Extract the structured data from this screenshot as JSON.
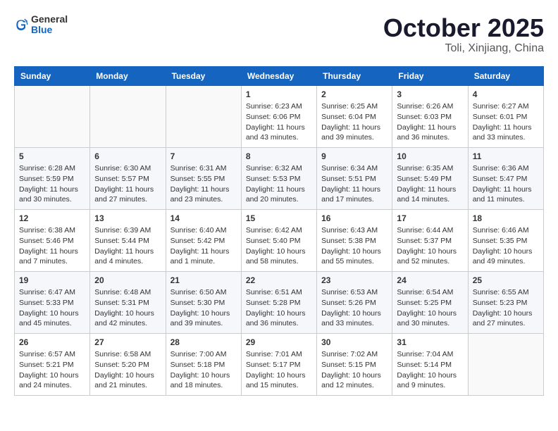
{
  "header": {
    "logo_line1": "General",
    "logo_line2": "Blue",
    "month_title": "October 2025",
    "location": "Toli, Xinjiang, China"
  },
  "weekdays": [
    "Sunday",
    "Monday",
    "Tuesday",
    "Wednesday",
    "Thursday",
    "Friday",
    "Saturday"
  ],
  "weeks": [
    [
      {
        "day": "",
        "sunrise": "",
        "sunset": "",
        "daylight": ""
      },
      {
        "day": "",
        "sunrise": "",
        "sunset": "",
        "daylight": ""
      },
      {
        "day": "",
        "sunrise": "",
        "sunset": "",
        "daylight": ""
      },
      {
        "day": "1",
        "sunrise": "Sunrise: 6:23 AM",
        "sunset": "Sunset: 6:06 PM",
        "daylight": "Daylight: 11 hours and 43 minutes."
      },
      {
        "day": "2",
        "sunrise": "Sunrise: 6:25 AM",
        "sunset": "Sunset: 6:04 PM",
        "daylight": "Daylight: 11 hours and 39 minutes."
      },
      {
        "day": "3",
        "sunrise": "Sunrise: 6:26 AM",
        "sunset": "Sunset: 6:03 PM",
        "daylight": "Daylight: 11 hours and 36 minutes."
      },
      {
        "day": "4",
        "sunrise": "Sunrise: 6:27 AM",
        "sunset": "Sunset: 6:01 PM",
        "daylight": "Daylight: 11 hours and 33 minutes."
      }
    ],
    [
      {
        "day": "5",
        "sunrise": "Sunrise: 6:28 AM",
        "sunset": "Sunset: 5:59 PM",
        "daylight": "Daylight: 11 hours and 30 minutes."
      },
      {
        "day": "6",
        "sunrise": "Sunrise: 6:30 AM",
        "sunset": "Sunset: 5:57 PM",
        "daylight": "Daylight: 11 hours and 27 minutes."
      },
      {
        "day": "7",
        "sunrise": "Sunrise: 6:31 AM",
        "sunset": "Sunset: 5:55 PM",
        "daylight": "Daylight: 11 hours and 23 minutes."
      },
      {
        "day": "8",
        "sunrise": "Sunrise: 6:32 AM",
        "sunset": "Sunset: 5:53 PM",
        "daylight": "Daylight: 11 hours and 20 minutes."
      },
      {
        "day": "9",
        "sunrise": "Sunrise: 6:34 AM",
        "sunset": "Sunset: 5:51 PM",
        "daylight": "Daylight: 11 hours and 17 minutes."
      },
      {
        "day": "10",
        "sunrise": "Sunrise: 6:35 AM",
        "sunset": "Sunset: 5:49 PM",
        "daylight": "Daylight: 11 hours and 14 minutes."
      },
      {
        "day": "11",
        "sunrise": "Sunrise: 6:36 AM",
        "sunset": "Sunset: 5:47 PM",
        "daylight": "Daylight: 11 hours and 11 minutes."
      }
    ],
    [
      {
        "day": "12",
        "sunrise": "Sunrise: 6:38 AM",
        "sunset": "Sunset: 5:46 PM",
        "daylight": "Daylight: 11 hours and 7 minutes."
      },
      {
        "day": "13",
        "sunrise": "Sunrise: 6:39 AM",
        "sunset": "Sunset: 5:44 PM",
        "daylight": "Daylight: 11 hours and 4 minutes."
      },
      {
        "day": "14",
        "sunrise": "Sunrise: 6:40 AM",
        "sunset": "Sunset: 5:42 PM",
        "daylight": "Daylight: 11 hours and 1 minute."
      },
      {
        "day": "15",
        "sunrise": "Sunrise: 6:42 AM",
        "sunset": "Sunset: 5:40 PM",
        "daylight": "Daylight: 10 hours and 58 minutes."
      },
      {
        "day": "16",
        "sunrise": "Sunrise: 6:43 AM",
        "sunset": "Sunset: 5:38 PM",
        "daylight": "Daylight: 10 hours and 55 minutes."
      },
      {
        "day": "17",
        "sunrise": "Sunrise: 6:44 AM",
        "sunset": "Sunset: 5:37 PM",
        "daylight": "Daylight: 10 hours and 52 minutes."
      },
      {
        "day": "18",
        "sunrise": "Sunrise: 6:46 AM",
        "sunset": "Sunset: 5:35 PM",
        "daylight": "Daylight: 10 hours and 49 minutes."
      }
    ],
    [
      {
        "day": "19",
        "sunrise": "Sunrise: 6:47 AM",
        "sunset": "Sunset: 5:33 PM",
        "daylight": "Daylight: 10 hours and 45 minutes."
      },
      {
        "day": "20",
        "sunrise": "Sunrise: 6:48 AM",
        "sunset": "Sunset: 5:31 PM",
        "daylight": "Daylight: 10 hours and 42 minutes."
      },
      {
        "day": "21",
        "sunrise": "Sunrise: 6:50 AM",
        "sunset": "Sunset: 5:30 PM",
        "daylight": "Daylight: 10 hours and 39 minutes."
      },
      {
        "day": "22",
        "sunrise": "Sunrise: 6:51 AM",
        "sunset": "Sunset: 5:28 PM",
        "daylight": "Daylight: 10 hours and 36 minutes."
      },
      {
        "day": "23",
        "sunrise": "Sunrise: 6:53 AM",
        "sunset": "Sunset: 5:26 PM",
        "daylight": "Daylight: 10 hours and 33 minutes."
      },
      {
        "day": "24",
        "sunrise": "Sunrise: 6:54 AM",
        "sunset": "Sunset: 5:25 PM",
        "daylight": "Daylight: 10 hours and 30 minutes."
      },
      {
        "day": "25",
        "sunrise": "Sunrise: 6:55 AM",
        "sunset": "Sunset: 5:23 PM",
        "daylight": "Daylight: 10 hours and 27 minutes."
      }
    ],
    [
      {
        "day": "26",
        "sunrise": "Sunrise: 6:57 AM",
        "sunset": "Sunset: 5:21 PM",
        "daylight": "Daylight: 10 hours and 24 minutes."
      },
      {
        "day": "27",
        "sunrise": "Sunrise: 6:58 AM",
        "sunset": "Sunset: 5:20 PM",
        "daylight": "Daylight: 10 hours and 21 minutes."
      },
      {
        "day": "28",
        "sunrise": "Sunrise: 7:00 AM",
        "sunset": "Sunset: 5:18 PM",
        "daylight": "Daylight: 10 hours and 18 minutes."
      },
      {
        "day": "29",
        "sunrise": "Sunrise: 7:01 AM",
        "sunset": "Sunset: 5:17 PM",
        "daylight": "Daylight: 10 hours and 15 minutes."
      },
      {
        "day": "30",
        "sunrise": "Sunrise: 7:02 AM",
        "sunset": "Sunset: 5:15 PM",
        "daylight": "Daylight: 10 hours and 12 minutes."
      },
      {
        "day": "31",
        "sunrise": "Sunrise: 7:04 AM",
        "sunset": "Sunset: 5:14 PM",
        "daylight": "Daylight: 10 hours and 9 minutes."
      },
      {
        "day": "",
        "sunrise": "",
        "sunset": "",
        "daylight": ""
      }
    ]
  ]
}
